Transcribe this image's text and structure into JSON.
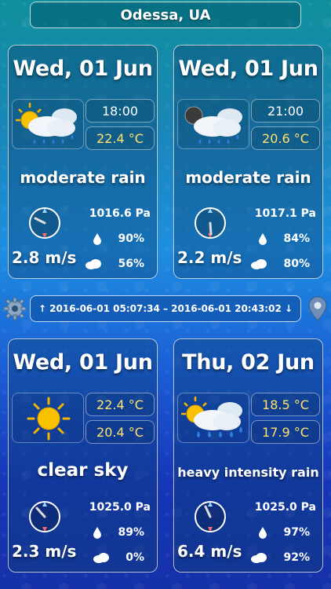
{
  "location": "Odessa, UA",
  "sun_info": "↑ 2016-06-01 05:07:34 – 2016-06-01 20:43:02 ↓",
  "icons": {
    "settings": "gear-icon",
    "location": "map-pin-icon",
    "humidity": "water-drop-icon",
    "clouds": "cloud-icon"
  },
  "colors": {
    "temp": "#ffe36e",
    "accent": "#1e8fe0"
  },
  "cards": [
    {
      "date": "Wed, 01 Jun",
      "icon": "sun-cloud-rain-icon",
      "line1": "18:00",
      "line2": "22.4 °C",
      "description": "moderate rain",
      "wind": "2.8 m/s",
      "pressure": "1016.6 Pa",
      "humidity": "90%",
      "clouds": "56%"
    },
    {
      "date": "Wed, 01 Jun",
      "icon": "moon-cloud-rain-icon",
      "line1": "21:00",
      "line2": "20.6 °C",
      "description": "moderate rain",
      "wind": "2.2 m/s",
      "pressure": "1017.1 Pa",
      "humidity": "84%",
      "clouds": "80%"
    },
    {
      "date": "Wed, 01 Jun",
      "icon": "sun-icon",
      "line1": "22.4 °C",
      "line2": "20.4 °C",
      "description": "clear sky",
      "wind": "2.3 m/s",
      "pressure": "1025.0 Pa",
      "humidity": "89%",
      "clouds": "0%"
    },
    {
      "date": "Thu, 02 Jun",
      "icon": "sun-cloud-heavy-rain-icon",
      "line1": "18.5 °C",
      "line2": "17.9 °C",
      "description": "heavy intensity rain",
      "wind": "6.4 m/s",
      "pressure": "1025.0 Pa",
      "humidity": "97%",
      "clouds": "92%"
    }
  ]
}
